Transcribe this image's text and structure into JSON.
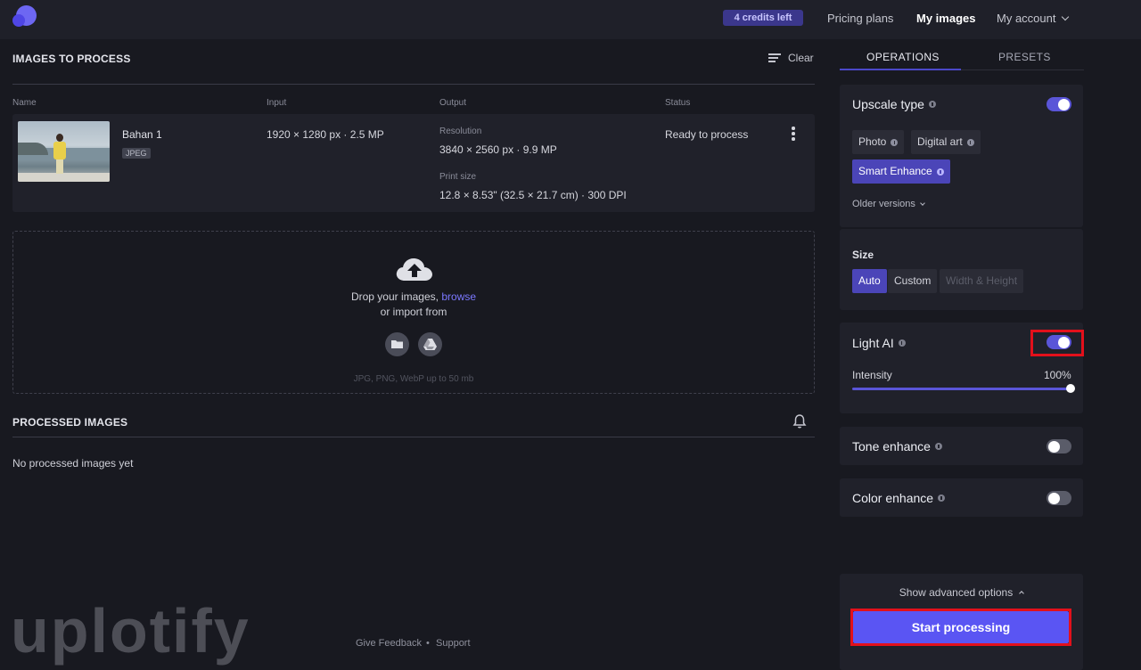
{
  "topbar": {
    "credits": "4 credits left",
    "nav": {
      "pricing": "Pricing plans",
      "my_images": "My images",
      "my_account": "My account"
    }
  },
  "to_process": {
    "title": "IMAGES TO PROCESS",
    "clear_label": "Clear",
    "columns": {
      "name": "Name",
      "input": "Input",
      "output": "Output",
      "status": "Status"
    },
    "row": {
      "name": "Bahan 1",
      "type": "JPEG",
      "input": "1920 × 1280 px · 2.5 MP",
      "resolution_label": "Resolution",
      "resolution": "3840 × 2560 px · 9.9 MP",
      "print_label": "Print size",
      "print": "12.8 × 8.53\" (32.5 × 21.7 cm) · 300 DPI",
      "status": "Ready to process"
    }
  },
  "dropzone": {
    "drop_text": "Drop your images,",
    "browse": "browse",
    "import_text": "or import from",
    "hint": "JPG, PNG, WebP up to 50 mb"
  },
  "processed": {
    "title": "PROCESSED IMAGES",
    "empty": "No processed images yet"
  },
  "watermark": "uplotify",
  "footer": {
    "feedback": "Give Feedback",
    "separator": "•",
    "support": "Support"
  },
  "panel": {
    "tabs": {
      "operations": "OPERATIONS",
      "presets": "PRESETS"
    },
    "upscale": {
      "title": "Upscale type",
      "enabled": true,
      "options": {
        "photo": "Photo",
        "digital_art": "Digital art",
        "smart_enhance": "Smart Enhance"
      },
      "selected": "Smart Enhance",
      "older": "Older versions"
    },
    "size": {
      "title": "Size",
      "auto": "Auto",
      "custom": "Custom",
      "wh": "Width & Height",
      "selected": "Auto"
    },
    "light_ai": {
      "title": "Light AI",
      "enabled": true,
      "intensity_label": "Intensity",
      "intensity_value": "100%",
      "intensity": 1.0
    },
    "tone": {
      "title": "Tone enhance",
      "enabled": false
    },
    "color": {
      "title": "Color enhance",
      "enabled": false
    },
    "advanced": "Show advanced options",
    "start": "Start processing"
  },
  "colors": {
    "accent": "#5a55f3",
    "highlight": "#e3101b",
    "background": "#181920"
  }
}
